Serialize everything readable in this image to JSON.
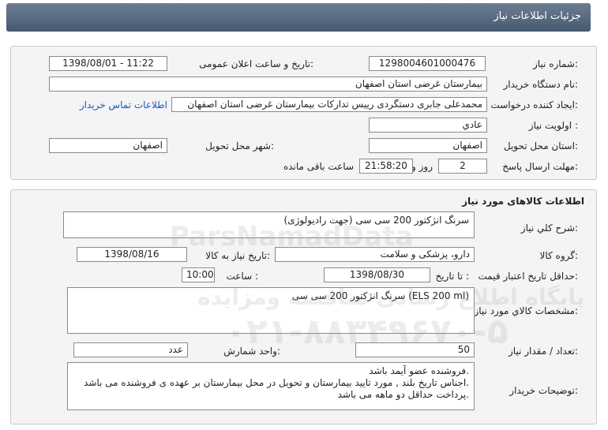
{
  "header": {
    "title": "جزئیات اطلاعات نیاز"
  },
  "info": {
    "need_number_label": "شماره نیاز:",
    "need_number": "1298004601000476",
    "announce_label": "تاریخ و ساعت اعلان عمومی:",
    "announce_value": "1398/08/01 - 11:22",
    "buyer_label": "نام دستگاه خریدار:",
    "buyer_value": "بیمارستان غرضی استان اصفهان",
    "creator_label": "ایجاد کننده درخواست:",
    "creator_value": "محمدعلی جابری دستگردی رییس تدارکات بیمارستان غرضی استان اصفهان",
    "contact_link": "اطلاعات تماس خریدار",
    "priority_label": "اولویت نیاز :",
    "priority_value": "عادي",
    "province_label": "استان محل تحویل:",
    "province_value": "اصفهان",
    "city_label": "شهر محل تحویل:",
    "city_value": "اصفهان",
    "deadline_label": "مهلت ارسال پاسخ:",
    "days_value": "2",
    "days_word": "روز و",
    "time_value": "21:58:20",
    "remaining_text": "ساعت باقی مانده"
  },
  "goods": {
    "section_title": "اطلاعات کالاهای مورد نیاز",
    "desc_label": "شرح کلي نیاز:",
    "desc_value": "سرنگ انژکتور 200 سی سی (جهت رادیولوژی)",
    "group_label": "گروه کالا:",
    "group_value": "دارو، پزشکی و سلامت",
    "need_date_label": "تاریخ نیاز به کالا:",
    "need_date_value": "1398/08/16",
    "validity_label": "حداقل تاریخ اعتبار قیمت:",
    "until_label": "تا تاریخ :",
    "validity_date": "1398/08/30",
    "hour_label": "ساعت :",
    "validity_time": "10:00",
    "specs_label": "مشخصات کالاي مورد نیاز:",
    "specs_value": "سرنگ انژکتور 200 سی سی (ELS 200 ml)",
    "qty_label": "تعداد / مقدار نیاز:",
    "qty_value": "50",
    "unit_label": "واحد شمارش:",
    "unit_value": "عدد",
    "buyer_notes_label": "توضیحات خریدار:",
    "buyer_notes": [
      "فروشنده عضو آیمد باشد.",
      "اجناس تاریخ بلند , مورد تایید بیمارستان و تحویل در محل بیمارستان بر عهده ی فروشنده می باشد.",
      "پرداخت حداقل دو ماهه می باشد."
    ]
  },
  "watermark": {
    "brand": "ParsNamadData",
    "line1": "پایگاه اطلاع رسانی مناقصه ومزایده",
    "phone": "۰۲۱-۸۸۳۴۹۶۷۰-۵"
  }
}
